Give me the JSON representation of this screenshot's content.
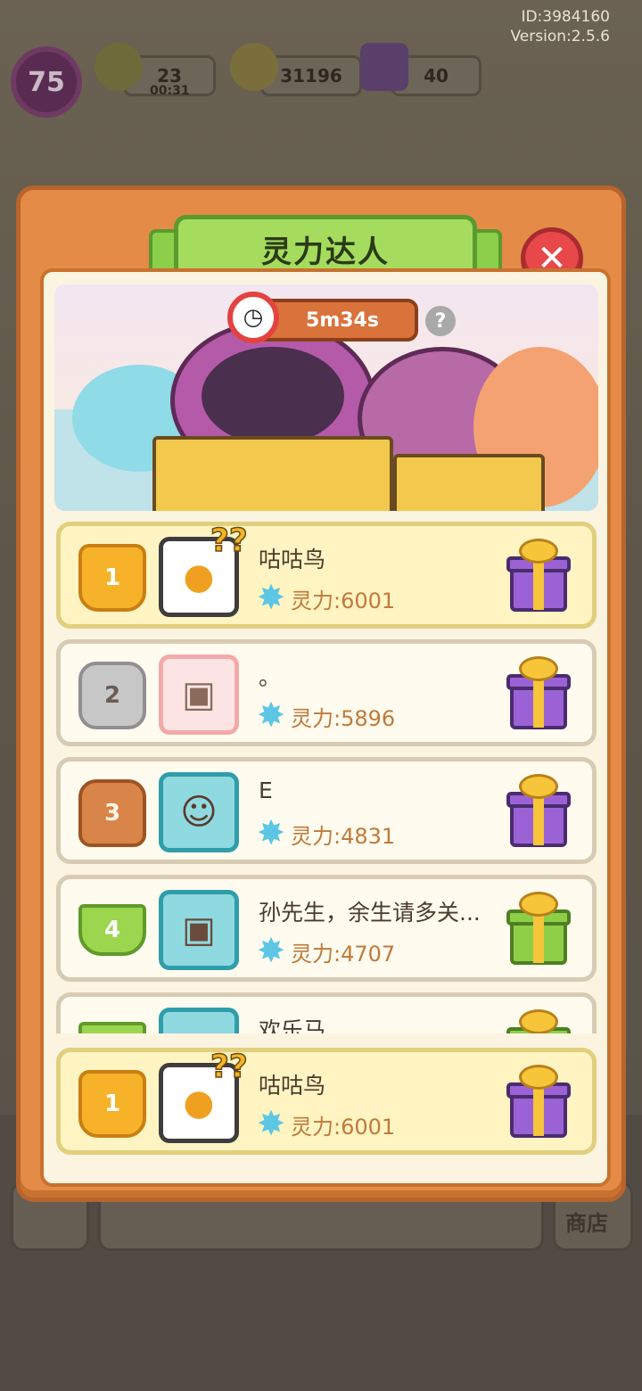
{
  "device": {
    "id_text": "ID:3984160",
    "version_text": "Version:2.5.6"
  },
  "hud": {
    "level": "75",
    "energy": "23",
    "energy_timer": "00:31",
    "coins": "31196",
    "gems": "40"
  },
  "background": {
    "shop_label": "商店"
  },
  "panel": {
    "title": "灵力达人",
    "close_icon": "close-icon",
    "timer": "5m34s",
    "help_label": "?"
  },
  "ranking": [
    {
      "rank": "1",
      "name": "咕咕鸟",
      "power": "灵力:6001",
      "badge": "gold",
      "gift": "purple"
    },
    {
      "rank": "2",
      "name": "。",
      "power": "灵力:5896",
      "badge": "silver",
      "gift": "purple"
    },
    {
      "rank": "3",
      "name": "E",
      "power": "灵力:4831",
      "badge": "bronze",
      "gift": "purple"
    },
    {
      "rank": "4",
      "name": "孙先生，余生请多关...",
      "power": "灵力:4707",
      "badge": "green",
      "gift": "green"
    },
    {
      "rank": "",
      "name": "欢乐马",
      "power": "",
      "badge": "green",
      "gift": "green"
    }
  ],
  "my_rank": {
    "rank": "1",
    "name": "咕咕鸟",
    "power": "灵力:6001"
  },
  "colors": {
    "panel_orange": "#e48b47",
    "title_green": "#a5dc5e",
    "close_red": "#e8484a",
    "power_text": "#c07a3a",
    "star_blue": "#5cc6e4"
  }
}
